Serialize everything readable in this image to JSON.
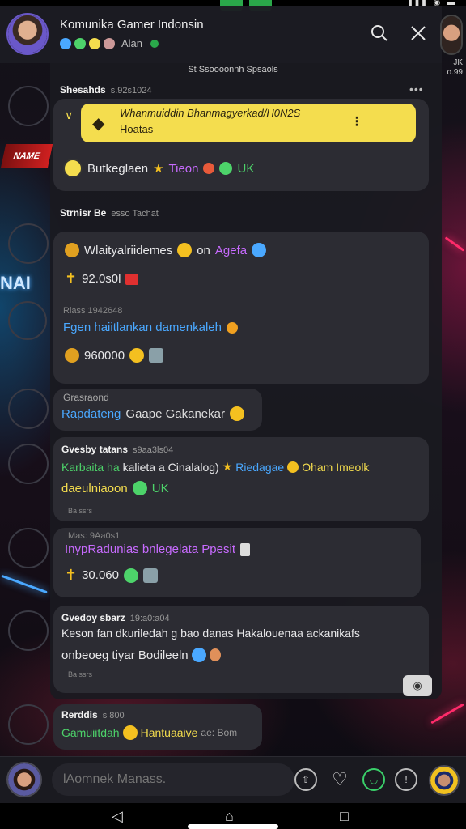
{
  "header": {
    "title": "Komunika Gamer Indonsin",
    "status_text": "Alan",
    "search_icon": "search-icon",
    "close_icon": "close-icon",
    "side_label_1": "JK",
    "side_label_2": "o.99"
  },
  "caption": "Ѕt Ѕsoooonnh Ѕpsaols",
  "messages": [
    {
      "sender": "Shesahds",
      "time": "s.92s1024",
      "reply_line1": "Whanmuiddin Bhanmagyerkad/H0N2S",
      "reply_line2": "Hoatas",
      "line1": "Butkeglaen",
      "line1_colored_1": "Tieon",
      "line1_colored_2": "UK"
    },
    {
      "sender": "Strnisr Be",
      "time": "esso Tachat",
      "line1": "Wlaityalriidemes",
      "line1_extra": "on",
      "line1_colored": "Agefa",
      "line2": "92.0s0l",
      "sub_meta": "Rlass 1942648",
      "line3": "Fgen haiitlankan damenkaleh",
      "line4": "960000"
    },
    {
      "sender": "Grasraond",
      "line1_colored": "Rapdateng",
      "line1": "Gaape Gakanekar"
    },
    {
      "sender": "Gvesby tatans",
      "time": "s9aa3ls04",
      "line1_green": "Karbaita ha",
      "line1": "kalieta a Cinalalog)",
      "line1_blue": "Riedagae",
      "line1_yellow": "Oham Imeolk",
      "line2_yellow": "daeulniaoon",
      "line2_green": "UK",
      "meta": "Ba ssrs"
    },
    {
      "sub_meta": "Mas: 9Aa0s1",
      "line1_colored": "InypRadunias bnlegelata Ppesit",
      "line2": "30.060"
    },
    {
      "sender": "Gvedoy sbarz",
      "time": "19:a0:a04",
      "line1": "Keson fan dkuriledah g bao danas Hakalouenaa ackanikafs",
      "line2_a": "onbeoeg",
      "line2_b": "tiyar Bodileeln",
      "meta": "Ba ssrs"
    },
    {
      "sender": "Rerddis",
      "time": "s 800",
      "line1_green": "Gamuiitdah",
      "line1_yellow": "Hantuaaive",
      "line1_meta": "ae: Bom"
    }
  ],
  "composer": {
    "placeholder": "lAomnek Manass."
  },
  "colors": {
    "accent_yellow": "#f4dd4e",
    "accent_purple": "#c86bff",
    "accent_blue": "#4aa8ff",
    "accent_green": "#4dd36a"
  }
}
